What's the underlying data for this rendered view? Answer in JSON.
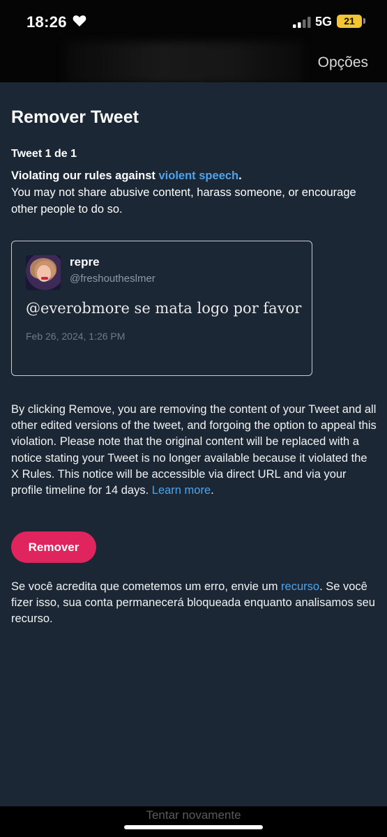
{
  "status_bar": {
    "time": "18:26",
    "network": "5G",
    "battery": "21"
  },
  "header": {
    "options_label": "Opções"
  },
  "sheet": {
    "title": "Remover Tweet",
    "counter": "Tweet 1 de 1",
    "rule_prefix": "Violating our rules against ",
    "rule_link": "violent speech",
    "rule_suffix": ".",
    "rule_description": "You may not share abusive content, harass someone, or encourage other people to do so."
  },
  "tweet": {
    "username": "repre",
    "handle": "@freshoutheslmer",
    "text": "@everobmore se mata logo por favor",
    "date": "Feb 26, 2024, 1:26 PM"
  },
  "notice": {
    "text": "By clicking Remove, you are removing the content of your Tweet and all other edited versions of the tweet, and forgoing the option to appeal this violation. Please note that the original content will be replaced with a notice stating your Tweet is no longer available because it violated the X Rules. This notice will be accessible via direct URL and via your profile timeline for 14 days. ",
    "learn_more": "Learn more",
    "end": "."
  },
  "remove_button": "Remover",
  "appeal": {
    "prefix": "Se você acredita que cometemos um erro, envie um ",
    "link": "recurso",
    "suffix": ". Se você fizer isso, sua conta permanecerá bloqueada enquanto analisamos seu recurso."
  },
  "bottom": {
    "retry": "Tentar novamente"
  },
  "colors": {
    "sheet_bg": "#1b2734",
    "link": "#4ea3eb",
    "remove_button": "#e0245e",
    "battery": "#f4c532"
  }
}
